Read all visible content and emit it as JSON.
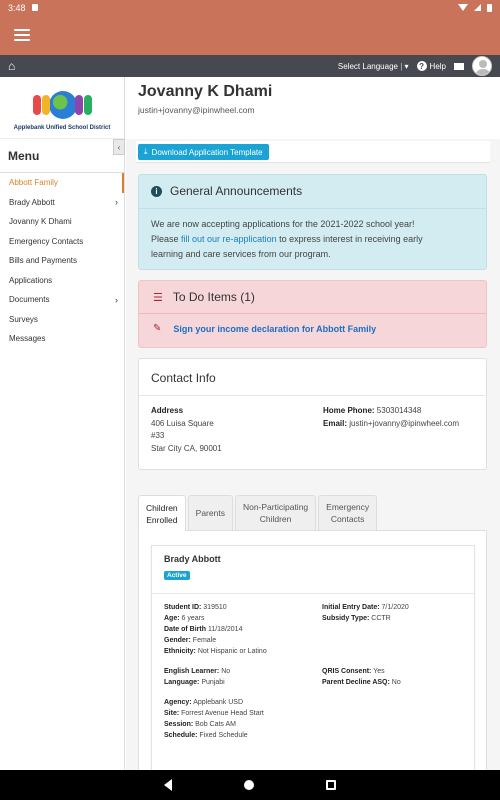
{
  "status": {
    "time": "3:48"
  },
  "topnav": {
    "language_label": "Select Language",
    "help_label": "Help"
  },
  "logo": {
    "caption": "Applebank Unified School District"
  },
  "sidebar": {
    "title": "Menu",
    "collapse_glyph": "‹",
    "items": [
      {
        "label": "Abbott Family",
        "active": true,
        "chevron": false
      },
      {
        "label": "Brady Abbott",
        "chevron": true
      },
      {
        "label": "Jovanny K Dhami",
        "chevron": false
      },
      {
        "label": "Emergency Contacts",
        "chevron": false
      },
      {
        "label": "Bills and Payments",
        "chevron": false
      },
      {
        "label": "Applications",
        "chevron": false
      },
      {
        "label": "Documents",
        "chevron": true
      },
      {
        "label": "Surveys",
        "chevron": false
      },
      {
        "label": "Messages",
        "chevron": false
      }
    ]
  },
  "profile": {
    "name": "Jovanny K Dhami",
    "email": "justin+jovanny@ipinwheel.com"
  },
  "download": {
    "label": "Download Application Template"
  },
  "announcements": {
    "title": "General Announcements",
    "line1": "We are now accepting applications for the 2021-2022 school year!",
    "line2_prefix": "Please ",
    "line2_link": "fill out our re-application",
    "line2_suffix": " to express interest in receiving early",
    "line3": "learning and care services from our program."
  },
  "todo": {
    "title": "To Do Items (1)",
    "item": "Sign your income declaration for Abbott Family"
  },
  "contact": {
    "title": "Contact Info",
    "address_label": "Address",
    "address_lines": [
      "406 Luisa Square",
      "#33",
      "Star City CA, 90001"
    ],
    "home_phone_label": "Home Phone:",
    "home_phone": "5303014348",
    "email_label": "Email:",
    "email": "justin+jovanny@ipinwheel.com"
  },
  "tabs": [
    {
      "line1": "Children",
      "line2": "Enrolled",
      "active": true
    },
    {
      "line1": "Parents",
      "line2": ""
    },
    {
      "line1": "Non-Participating",
      "line2": "Children"
    },
    {
      "line1": "Emergency",
      "line2": "Contacts"
    }
  ],
  "child": {
    "name": "Brady Abbott",
    "status": "Active",
    "student_id_label": "Student ID:",
    "student_id": "319510",
    "age_label": "Age:",
    "age": "6 years",
    "dob_label": "Date of Birth",
    "dob": "11/18/2014",
    "gender_label": "Gender:",
    "gender": "Female",
    "ethnicity_label": "Ethnicity:",
    "ethnicity": "Not Hispanic or Latino",
    "initial_entry_label": "Initial Entry Date:",
    "initial_entry": "7/1/2020",
    "subsidy_label": "Subsidy Type:",
    "subsidy": "CCTR",
    "english_label": "English Learner:",
    "english": "No",
    "language_label": "Language:",
    "language": "Punjabi",
    "qris_label": "QRIS Consent:",
    "qris": "Yes",
    "asq_label": "Parent Decline ASQ:",
    "asq": "No",
    "agency_label": "Agency:",
    "agency": "Applebank USD",
    "site_label": "Site:",
    "site": "Forrest Avenue Head Start",
    "session_label": "Session:",
    "session": "Bob Cats AM",
    "schedule_label": "Schedule:",
    "schedule": "Fixed Schedule"
  }
}
